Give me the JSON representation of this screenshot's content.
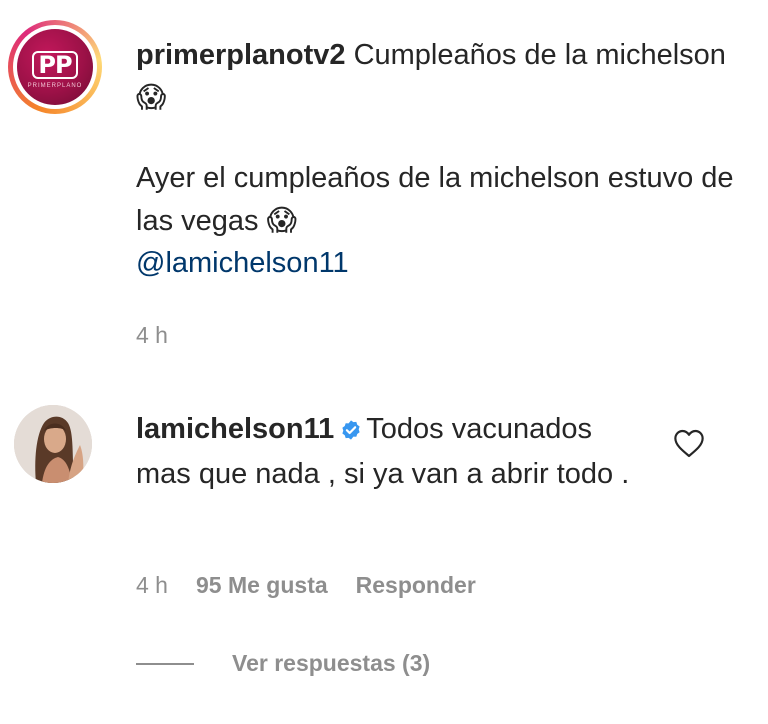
{
  "post": {
    "avatar_logo_text": "PP",
    "avatar_logo_subtext": "PRIMERPLANO",
    "username": "primerplanotv2",
    "caption_title": "Cumpleaños de la michelson",
    "caption_title_emoji": "😱",
    "caption_body": "Ayer el cumpleaños de la michelson estuvo de las vegas",
    "caption_body_emoji": "😱",
    "mention": "@lamichelson11",
    "timestamp": "4 h"
  },
  "comment": {
    "username": "lamichelson11",
    "verified": true,
    "text": "Todos vacunados mas que nada , si ya van a abrir todo .",
    "timestamp": "4 h",
    "likes": "95 Me gusta",
    "reply_label": "Responder",
    "view_replies_label": "Ver respuestas (3)"
  },
  "colors": {
    "text": "#262626",
    "secondary": "#8e8e8e",
    "mention": "#00376b",
    "verified": "#3897f0",
    "brand": "#9c1147"
  },
  "icons": {
    "verified": "verified-badge-icon",
    "like": "heart-outline-icon"
  }
}
